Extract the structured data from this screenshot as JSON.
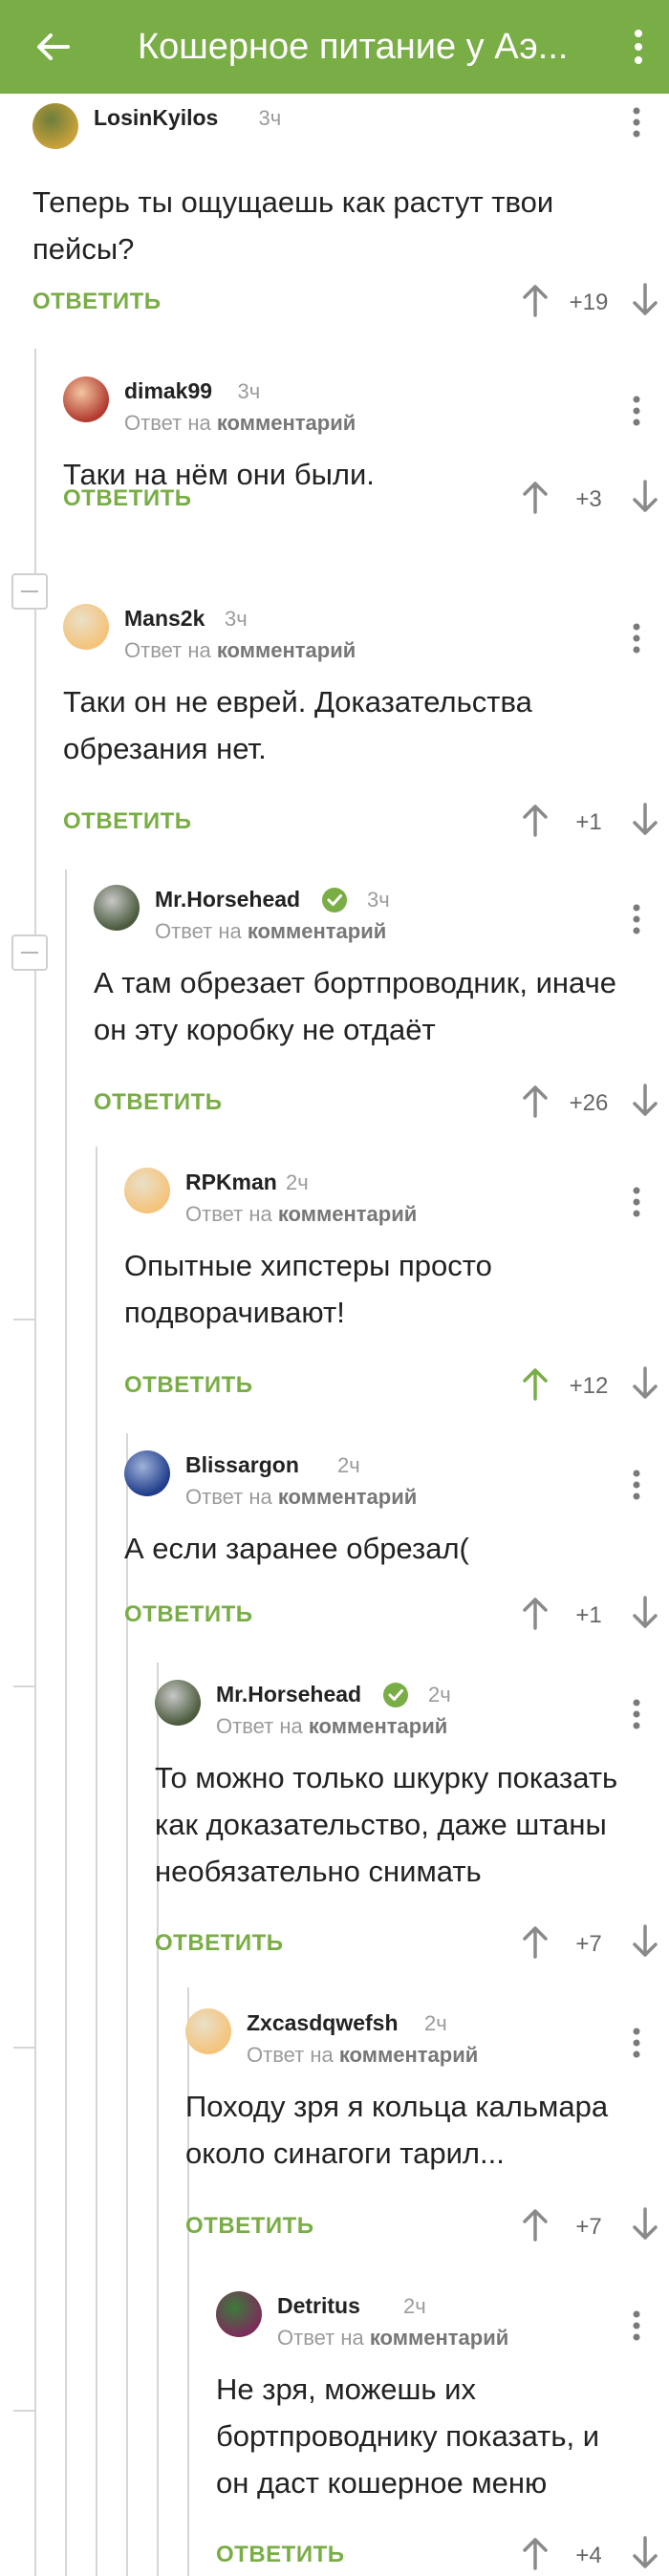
{
  "header": {
    "title": "Кошерное питание у Аэ...",
    "back_icon": "arrow-left-icon",
    "menu_icon": "kebab-menu-icon",
    "color": "#79ad45"
  },
  "labels": {
    "reply_prefix": "Ответ на",
    "reply_target": "комментарий",
    "reply_button": "ОТВЕТИТЬ"
  },
  "comments": [
    {
      "author": "LosinKyilos",
      "time": "3ч",
      "text": "Теперь ты ощущаешь как растут твои\nпейсы?",
      "score": "+19",
      "is_reply": false,
      "verified": false,
      "upvoted": false
    },
    {
      "author": "dimak99",
      "time": "3ч",
      "text": "Таки на нём они были.",
      "score": "+3",
      "is_reply": true,
      "verified": false,
      "upvoted": false
    },
    {
      "author": "Mans2k",
      "time": "3ч",
      "text": "Таки он не еврей. Доказательства\nобрезания нет.",
      "score": "+1",
      "is_reply": true,
      "verified": false,
      "upvoted": false
    },
    {
      "author": "Mr.Horsehead",
      "time": "3ч",
      "text": "А там обрезает бортпроводник, иначе\nон эту коробку не отдаёт",
      "score": "+26",
      "is_reply": true,
      "verified": true,
      "upvoted": false
    },
    {
      "author": "RPKman",
      "time": "2ч",
      "text": "Опытные хипстеры просто\nподворачивают!",
      "score": "+12",
      "is_reply": true,
      "verified": false,
      "upvoted": true
    },
    {
      "author": "Blissargon",
      "time": "2ч",
      "text": "А если заранее обрезал(",
      "score": "+1",
      "is_reply": true,
      "verified": false,
      "upvoted": false
    },
    {
      "author": "Mr.Horsehead",
      "time": "2ч",
      "text": "То можно только шкурку показать\nкак доказательство, даже штаны\nнеобязательно снимать",
      "score": "+7",
      "is_reply": true,
      "verified": true,
      "upvoted": false
    },
    {
      "author": "Zxcasdqwefsh",
      "time": "2ч",
      "text": "Походу зря я  кольца кальмара\nоколо синагоги  тарил...",
      "score": "+7",
      "is_reply": true,
      "verified": false,
      "upvoted": false
    },
    {
      "author": "Detritus",
      "time": "2ч",
      "text": "Не зря, можешь их\nбортпроводнику показать, и\nон даст кошерное меню",
      "score": "+4",
      "is_reply": true,
      "verified": false,
      "upvoted": false
    }
  ],
  "colors": {
    "accent": "#79ad45",
    "text": "#222222",
    "muted": "#9b9b9b",
    "upvote_active": "#79ad45",
    "arrow": "#8a8a8a"
  }
}
